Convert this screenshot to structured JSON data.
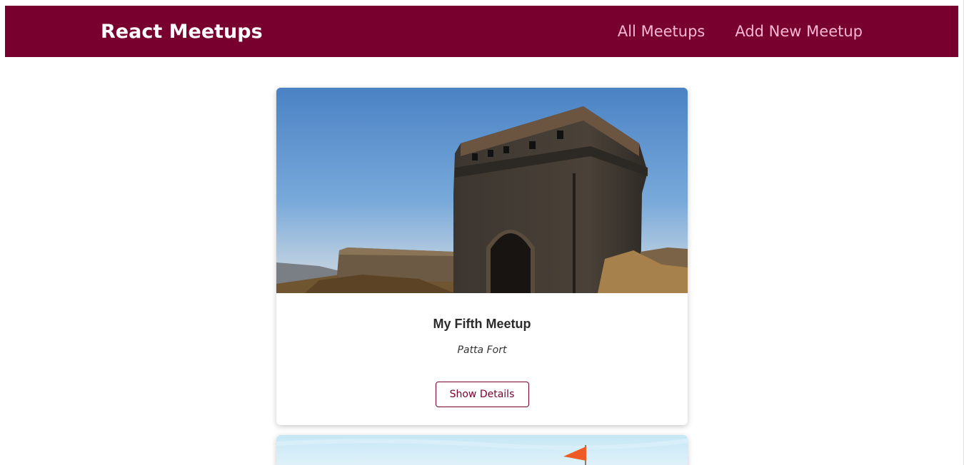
{
  "header": {
    "logo": "React Meetups",
    "nav": [
      {
        "label": "All Meetups"
      },
      {
        "label": "Add New Meetup"
      }
    ]
  },
  "meetups": [
    {
      "title": "My Fifth Meetup",
      "address": "Patta Fort",
      "action_label": "Show Details",
      "image_subject": "stone fort gate under blue sky"
    },
    {
      "image_subject": "snowy summit with orange flag"
    }
  ],
  "colors": {
    "header_bg": "#77002e",
    "nav_link": "#fcb8d2",
    "button_border": "#77002e"
  }
}
